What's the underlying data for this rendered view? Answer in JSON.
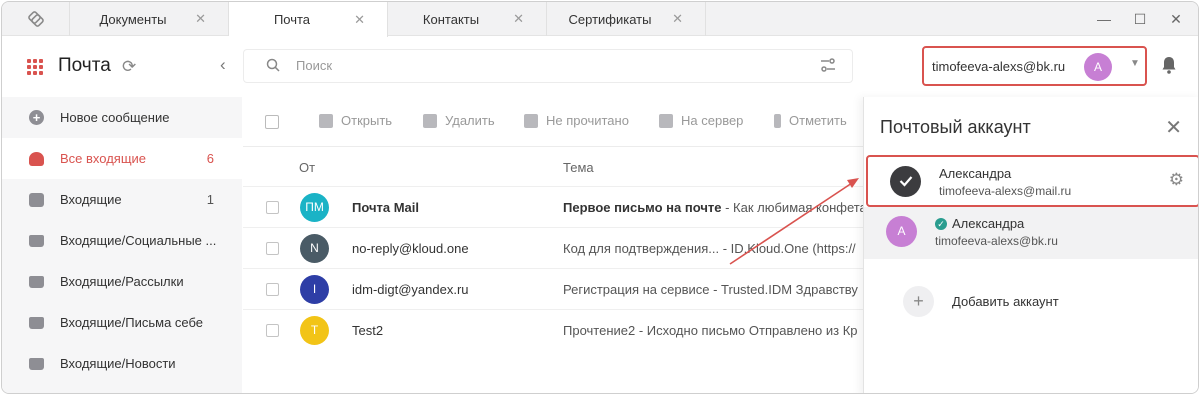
{
  "tabs": [
    {
      "label": "Документы",
      "close": "✕"
    },
    {
      "label": "Почта",
      "close": "✕"
    },
    {
      "label": "Контакты",
      "close": "✕"
    },
    {
      "label": "Сертификаты",
      "close": "✕"
    }
  ],
  "window": {
    "minimize": "—",
    "maximize": "☐",
    "close": "✕"
  },
  "sidebar": {
    "title": "Почта",
    "items": [
      {
        "label": "Новое сообщение",
        "count": ""
      },
      {
        "label": "Все входящие",
        "count": "6"
      },
      {
        "label": "Входящие",
        "count": "1"
      },
      {
        "label": "Входящие/Социальные ...",
        "count": ""
      },
      {
        "label": "Входящие/Рассылки",
        "count": ""
      },
      {
        "label": "Входящие/Письма себе",
        "count": ""
      },
      {
        "label": "Входящие/Новости",
        "count": ""
      }
    ]
  },
  "search": {
    "placeholder": "Поиск"
  },
  "account": {
    "email": "timofeeva-alexs@bk.ru",
    "avatar_letter": "A"
  },
  "toolbar": {
    "open": "Открыть",
    "delete": "Удалить",
    "unread": "Не прочитано",
    "to_server": "На сервер",
    "mark": "Отметить"
  },
  "list": {
    "col_from": "От",
    "col_subject": "Тема",
    "rows": [
      {
        "initials": "ПМ",
        "color": "#1ab3c6",
        "from": "Почта Mail",
        "subject_bold": "Первое письмо на почте",
        "subject_rest": " - Как любимая конфета",
        "bold": true
      },
      {
        "initials": "N",
        "color": "#4a5b66",
        "from": "no-reply@kloud.one",
        "subject_bold": "",
        "subject_rest": "Код для подтверждения...  -  ID.Kloud.One (https://",
        "bold": false
      },
      {
        "initials": "I",
        "color": "#2e3ea6",
        "from": "idm-digt@yandex.ru",
        "subject_bold": "",
        "subject_rest": "Регистрация на сервисе  -  Trusted.IDM Здравству",
        "bold": false
      },
      {
        "initials": "T",
        "color": "#f2c417",
        "from": "Test2",
        "subject_bold": "",
        "subject_rest": "Прочтение2  -  Исходно письмо Отправлено из Кр",
        "bold": false
      }
    ]
  },
  "panel": {
    "title": "Почтовый аккаунт",
    "accounts": [
      {
        "name": "Александра",
        "email": "timofeeva-alexs@mail.ru"
      },
      {
        "name": "Александра",
        "email": "timofeeva-alexs@bk.ru",
        "avatar_letter": "A"
      }
    ],
    "add_label": "Добавить аккаунт"
  },
  "colors": {
    "accent": "#d9534f",
    "avatar_purple": "#c77fd4",
    "verified": "#2a9d8f"
  }
}
